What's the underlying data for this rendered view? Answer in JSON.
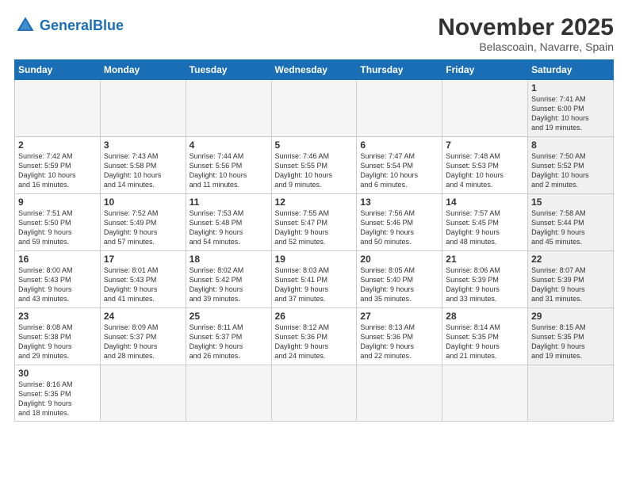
{
  "logo": {
    "text_general": "General",
    "text_blue": "Blue"
  },
  "title": "November 2025",
  "subtitle": "Belascoain, Navarre, Spain",
  "weekdays": [
    "Sunday",
    "Monday",
    "Tuesday",
    "Wednesday",
    "Thursday",
    "Friday",
    "Saturday"
  ],
  "weeks": [
    [
      {
        "day": "",
        "info": "",
        "empty": true
      },
      {
        "day": "",
        "info": "",
        "empty": true
      },
      {
        "day": "",
        "info": "",
        "empty": true
      },
      {
        "day": "",
        "info": "",
        "empty": true
      },
      {
        "day": "",
        "info": "",
        "empty": true
      },
      {
        "day": "",
        "info": "",
        "empty": true
      },
      {
        "day": "1",
        "info": "Sunrise: 7:41 AM\nSunset: 6:00 PM\nDaylight: 10 hours\nand 19 minutes.",
        "saturday": true
      }
    ],
    [
      {
        "day": "2",
        "info": "Sunrise: 7:42 AM\nSunset: 5:59 PM\nDaylight: 10 hours\nand 16 minutes."
      },
      {
        "day": "3",
        "info": "Sunrise: 7:43 AM\nSunset: 5:58 PM\nDaylight: 10 hours\nand 14 minutes."
      },
      {
        "day": "4",
        "info": "Sunrise: 7:44 AM\nSunset: 5:56 PM\nDaylight: 10 hours\nand 11 minutes."
      },
      {
        "day": "5",
        "info": "Sunrise: 7:46 AM\nSunset: 5:55 PM\nDaylight: 10 hours\nand 9 minutes."
      },
      {
        "day": "6",
        "info": "Sunrise: 7:47 AM\nSunset: 5:54 PM\nDaylight: 10 hours\nand 6 minutes."
      },
      {
        "day": "7",
        "info": "Sunrise: 7:48 AM\nSunset: 5:53 PM\nDaylight: 10 hours\nand 4 minutes."
      },
      {
        "day": "8",
        "info": "Sunrise: 7:50 AM\nSunset: 5:52 PM\nDaylight: 10 hours\nand 2 minutes.",
        "saturday": true
      }
    ],
    [
      {
        "day": "9",
        "info": "Sunrise: 7:51 AM\nSunset: 5:50 PM\nDaylight: 9 hours\nand 59 minutes."
      },
      {
        "day": "10",
        "info": "Sunrise: 7:52 AM\nSunset: 5:49 PM\nDaylight: 9 hours\nand 57 minutes."
      },
      {
        "day": "11",
        "info": "Sunrise: 7:53 AM\nSunset: 5:48 PM\nDaylight: 9 hours\nand 54 minutes."
      },
      {
        "day": "12",
        "info": "Sunrise: 7:55 AM\nSunset: 5:47 PM\nDaylight: 9 hours\nand 52 minutes."
      },
      {
        "day": "13",
        "info": "Sunrise: 7:56 AM\nSunset: 5:46 PM\nDaylight: 9 hours\nand 50 minutes."
      },
      {
        "day": "14",
        "info": "Sunrise: 7:57 AM\nSunset: 5:45 PM\nDaylight: 9 hours\nand 48 minutes."
      },
      {
        "day": "15",
        "info": "Sunrise: 7:58 AM\nSunset: 5:44 PM\nDaylight: 9 hours\nand 45 minutes.",
        "saturday": true
      }
    ],
    [
      {
        "day": "16",
        "info": "Sunrise: 8:00 AM\nSunset: 5:43 PM\nDaylight: 9 hours\nand 43 minutes."
      },
      {
        "day": "17",
        "info": "Sunrise: 8:01 AM\nSunset: 5:43 PM\nDaylight: 9 hours\nand 41 minutes."
      },
      {
        "day": "18",
        "info": "Sunrise: 8:02 AM\nSunset: 5:42 PM\nDaylight: 9 hours\nand 39 minutes."
      },
      {
        "day": "19",
        "info": "Sunrise: 8:03 AM\nSunset: 5:41 PM\nDaylight: 9 hours\nand 37 minutes."
      },
      {
        "day": "20",
        "info": "Sunrise: 8:05 AM\nSunset: 5:40 PM\nDaylight: 9 hours\nand 35 minutes."
      },
      {
        "day": "21",
        "info": "Sunrise: 8:06 AM\nSunset: 5:39 PM\nDaylight: 9 hours\nand 33 minutes."
      },
      {
        "day": "22",
        "info": "Sunrise: 8:07 AM\nSunset: 5:39 PM\nDaylight: 9 hours\nand 31 minutes.",
        "saturday": true
      }
    ],
    [
      {
        "day": "23",
        "info": "Sunrise: 8:08 AM\nSunset: 5:38 PM\nDaylight: 9 hours\nand 29 minutes."
      },
      {
        "day": "24",
        "info": "Sunrise: 8:09 AM\nSunset: 5:37 PM\nDaylight: 9 hours\nand 28 minutes."
      },
      {
        "day": "25",
        "info": "Sunrise: 8:11 AM\nSunset: 5:37 PM\nDaylight: 9 hours\nand 26 minutes."
      },
      {
        "day": "26",
        "info": "Sunrise: 8:12 AM\nSunset: 5:36 PM\nDaylight: 9 hours\nand 24 minutes."
      },
      {
        "day": "27",
        "info": "Sunrise: 8:13 AM\nSunset: 5:36 PM\nDaylight: 9 hours\nand 22 minutes."
      },
      {
        "day": "28",
        "info": "Sunrise: 8:14 AM\nSunset: 5:35 PM\nDaylight: 9 hours\nand 21 minutes."
      },
      {
        "day": "29",
        "info": "Sunrise: 8:15 AM\nSunset: 5:35 PM\nDaylight: 9 hours\nand 19 minutes.",
        "saturday": true
      }
    ],
    [
      {
        "day": "30",
        "info": "Sunrise: 8:16 AM\nSunset: 5:35 PM\nDaylight: 9 hours\nand 18 minutes."
      },
      {
        "day": "",
        "info": "",
        "empty": true
      },
      {
        "day": "",
        "info": "",
        "empty": true
      },
      {
        "day": "",
        "info": "",
        "empty": true
      },
      {
        "day": "",
        "info": "",
        "empty": true
      },
      {
        "day": "",
        "info": "",
        "empty": true
      },
      {
        "day": "",
        "info": "",
        "empty": true,
        "saturday": true
      }
    ]
  ]
}
